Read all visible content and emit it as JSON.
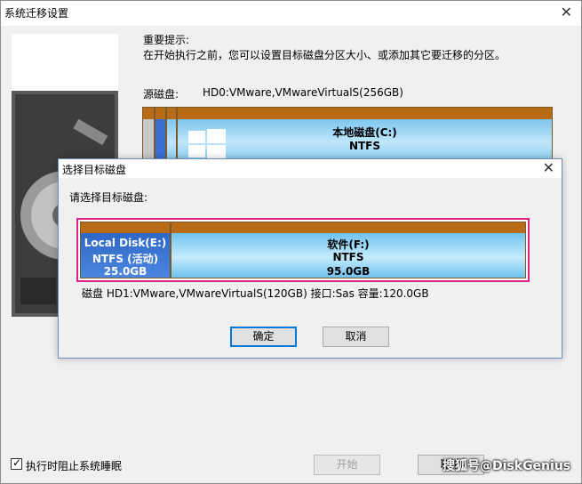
{
  "window": {
    "title": "系统迁移设置"
  },
  "hint": {
    "title": "重要提示:",
    "text": "在开始执行之前，您可以设置目标磁盘分区大小、或添加其它要迁移的分区。"
  },
  "source": {
    "label": "源磁盘:",
    "value": "HD0:VMware,VMwareVirtualS(256GB)",
    "partition_c": {
      "name": "本地磁盘(C:)",
      "fs": "NTFS"
    }
  },
  "dialog": {
    "title": "选择目标磁盘",
    "prompt": "请选择目标磁盘:",
    "partitions": [
      {
        "name": "Local Disk(E:)",
        "fs": "NTFS (活动)",
        "size": "25.0GB"
      },
      {
        "name": "软件(F:)",
        "fs": "NTFS",
        "size": "95.0GB"
      }
    ],
    "disk_info": "磁盘 HD1:VMware,VMwareVirtualS(120GB)  接口:Sas  容量:120.0GB",
    "ok": "确定",
    "cancel": "取消"
  },
  "footer": {
    "checkbox_label": "执行时阻止系统睡眠",
    "checkbox_checked": true,
    "start": "开始",
    "cancel_partial": "取消"
  },
  "watermark": "搜狐号@DiskGenius",
  "colors": {
    "partition_cap": "#b86a14",
    "selection_border": "#e0208a",
    "accent": "#0078d7"
  }
}
